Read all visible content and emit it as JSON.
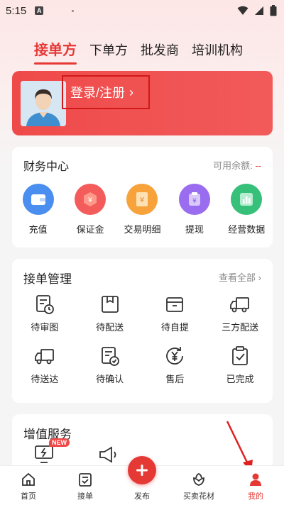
{
  "status_bar": {
    "time": "5:15",
    "badge": "A"
  },
  "top_tabs": [
    {
      "label": "接单方",
      "active": true
    },
    {
      "label": "下单方",
      "active": false
    },
    {
      "label": "批发商",
      "active": false
    },
    {
      "label": "培训机构",
      "active": false
    }
  ],
  "profile": {
    "login_label": "登录/注册",
    "chevron": "›"
  },
  "finance": {
    "title": "财务中心",
    "balance_label": "可用余额:",
    "balance_value": "--",
    "items": [
      {
        "label": "充值",
        "icon": "wallet-icon",
        "color": "#4a8ff0"
      },
      {
        "label": "保证金",
        "icon": "deposit-icon",
        "color": "#f45c5c"
      },
      {
        "label": "交易明细",
        "icon": "ledger-icon",
        "color": "#f7a23b"
      },
      {
        "label": "提现",
        "icon": "withdraw-icon",
        "color": "#9a6cf0"
      },
      {
        "label": "经营数据",
        "icon": "chart-icon",
        "color": "#36c07a"
      }
    ]
  },
  "orders": {
    "title": "接单管理",
    "view_all": "查看全部",
    "items": [
      {
        "label": "待审图",
        "icon": "review-icon"
      },
      {
        "label": "待配送",
        "icon": "package-icon"
      },
      {
        "label": "待自提",
        "icon": "box-icon"
      },
      {
        "label": "三方配送",
        "icon": "truck-icon"
      },
      {
        "label": "待送达",
        "icon": "delivery-truck-icon"
      },
      {
        "label": "待确认",
        "icon": "confirm-doc-icon"
      },
      {
        "label": "售后",
        "icon": "after-sales-icon"
      },
      {
        "label": "已完成",
        "icon": "clipboard-check-icon"
      }
    ]
  },
  "value_added": {
    "title": "增值服务",
    "new_badge": "NEW"
  },
  "bottom_nav": [
    {
      "label": "首页",
      "icon": "home-icon",
      "active": false
    },
    {
      "label": "接单",
      "icon": "order-icon",
      "active": false
    },
    {
      "label": "发布",
      "icon": "plus-icon",
      "active": false
    },
    {
      "label": "买卖花材",
      "icon": "flower-icon",
      "active": false
    },
    {
      "label": "我的",
      "icon": "user-icon",
      "active": true
    }
  ]
}
